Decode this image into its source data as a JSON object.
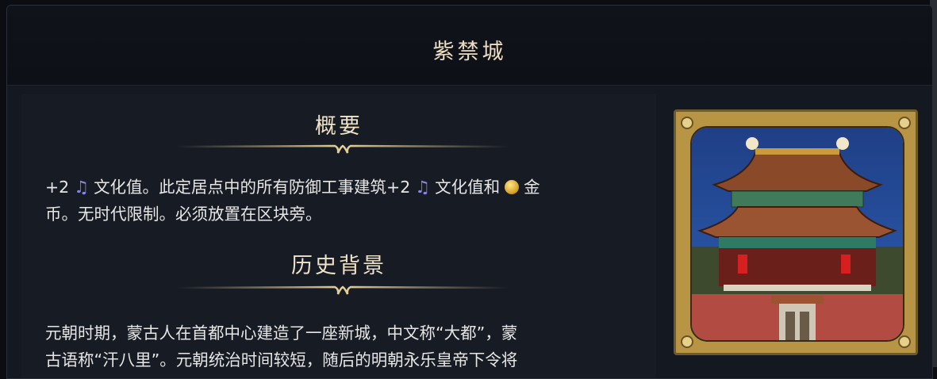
{
  "window": {
    "title": "紫禁城"
  },
  "overview": {
    "heading": "概要",
    "line1_part1": "+2",
    "line1_part2": "文化值。此定居点中的所有防御工事建筑+2",
    "line1_part3": "文化值和",
    "line1_part4": "金",
    "line2": "币。无时代限制。必须放置在区块旁。"
  },
  "history": {
    "heading": "历史背景",
    "line1": "元朝时期，蒙古人在首都中心建造了一座新城，中文称“大都”，蒙",
    "line2": "古语称“汗八里”。元朝统治时间较短，随后的明朝永乐皇帝下令将"
  },
  "icons": {
    "culture": "music-note-icon",
    "gold": "gold-coin-icon"
  },
  "colors": {
    "title_text": "#e9dcc0",
    "culture_icon": "#8a86e4",
    "gold_icon": "#d9a62b",
    "frame_gold": "#b79545"
  }
}
